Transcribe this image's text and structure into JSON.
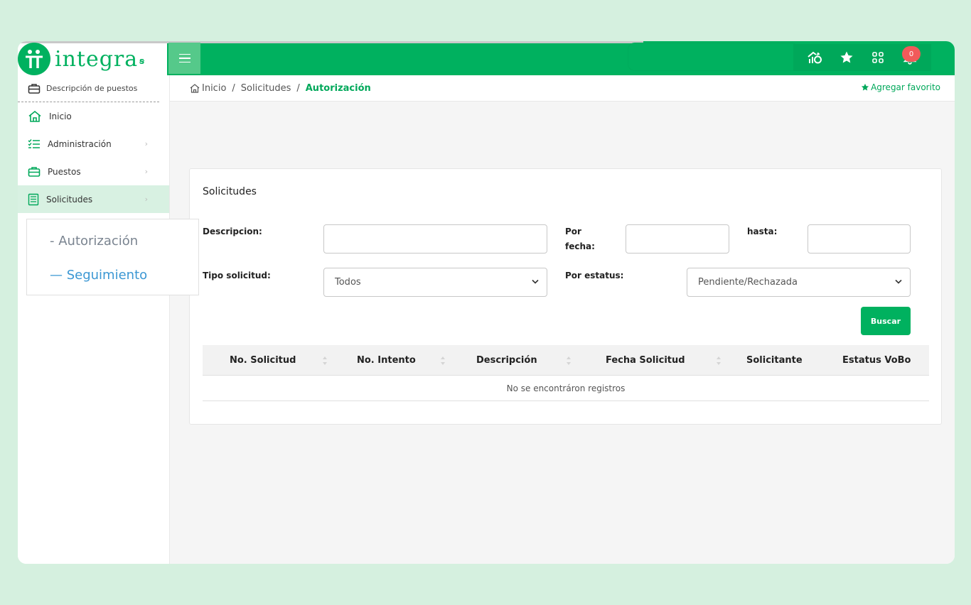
{
  "app": {
    "logo_text": "integra"
  },
  "header": {
    "notifications_count": "0",
    "icons": [
      "home-chart-icon",
      "star-icon",
      "apps-grid-icon",
      "bell-icon"
    ]
  },
  "sidebar": {
    "module_title": "Descripción de puestos",
    "items": [
      {
        "label": "Inicio",
        "icon": "home-icon"
      },
      {
        "label": "Administración",
        "icon": "checklist-icon"
      },
      {
        "label": "Puestos",
        "icon": "briefcase-icon"
      },
      {
        "label": "Solicitudes",
        "icon": "form-icon"
      }
    ],
    "submenu": [
      "- Autorización",
      "— Seguimiento"
    ]
  },
  "breadcrumb": {
    "home": "Inicio",
    "parent": "Solicitudes",
    "current": "Autorización",
    "favorite": "Agregar favorito"
  },
  "form": {
    "title": "Solicitudes",
    "descripcion_label": "Descripcion:",
    "descripcion_value": "",
    "por_fecha_label_1": "Por",
    "por_fecha_label_2": "fecha:",
    "fecha_desde_value": "",
    "hasta_label": "hasta:",
    "fecha_hasta_value": "",
    "tipo_label": "Tipo solicitud:",
    "tipo_value": "Todos",
    "estatus_label": "Por estatus:",
    "estatus_value": "Pendiente/Rechazada",
    "search_button": "Buscar"
  },
  "table": {
    "columns": [
      "No. Solicitud",
      "No. Intento",
      "Descripción",
      "Fecha Solicitud",
      "Solicitante",
      "Estatus VoBo"
    ],
    "empty_message": "No se encontráron registros"
  },
  "colors": {
    "brand_green": "#00b15f",
    "background": "#d5f0df",
    "badge_red": "#f15a5a",
    "link_blue": "#3b97d3"
  }
}
